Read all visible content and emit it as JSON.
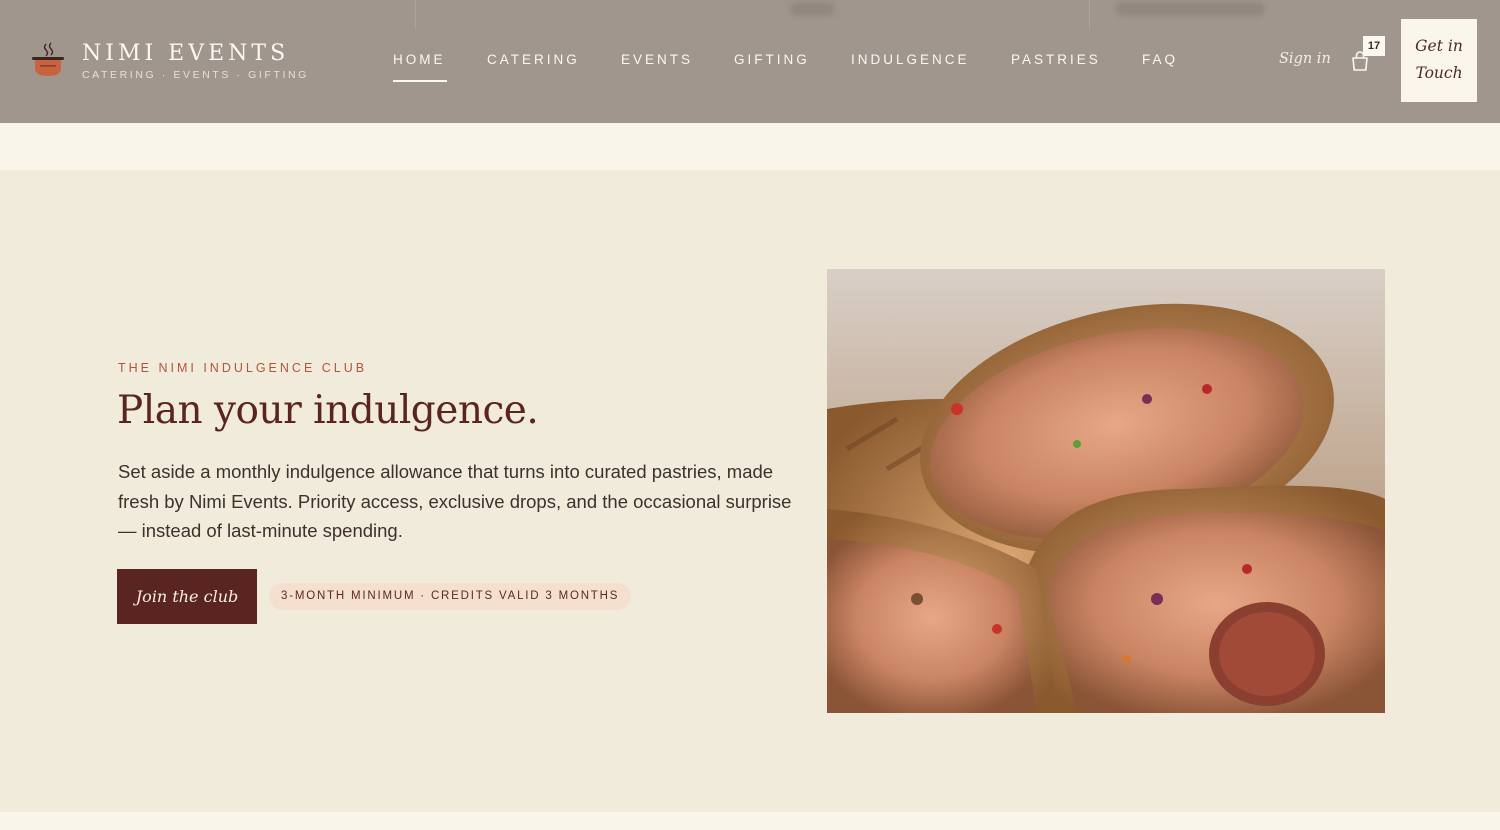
{
  "brand": {
    "name": "NIMI EVENTS",
    "tagline": "CATERING · EVENTS · GIFTING",
    "logo_icon": "steaming-pot-icon",
    "logo_color": "#c8623f"
  },
  "nav": {
    "items": [
      {
        "label": "HOME",
        "active": true
      },
      {
        "label": "CATERING",
        "active": false
      },
      {
        "label": "EVENTS",
        "active": false
      },
      {
        "label": "GIFTING",
        "active": false
      },
      {
        "label": "INDULGENCE",
        "active": false
      },
      {
        "label": "PASTRIES",
        "active": false
      },
      {
        "label": "FAQ",
        "active": false
      }
    ]
  },
  "header_actions": {
    "sign_in": "Sign in",
    "cart_icon": "shopping-bag-icon",
    "cart_count": "17",
    "cta_line1": "Get in",
    "cta_line2": "Touch"
  },
  "hero": {
    "eyebrow": "THE NIMI INDULGENCE CLUB",
    "title": "Plan your indulgence.",
    "body": "Set aside a monthly indulgence allowance that turns into curated pastries, made fresh by Nimi Events. Priority access, exclusive drops, and the occasional surprise — instead of last-minute spending.",
    "cta": "Join the club",
    "note": "3-MONTH MINIMUM · CREDITS VALID 3 MONTHS",
    "image_subject": "grilled-wrap-photo"
  },
  "colors": {
    "header_bg": "#a1968d",
    "page_bg": "#f1ebdb",
    "accent": "#5a2420",
    "eyebrow": "#b2553a",
    "pill_bg": "#f5dfcf"
  }
}
